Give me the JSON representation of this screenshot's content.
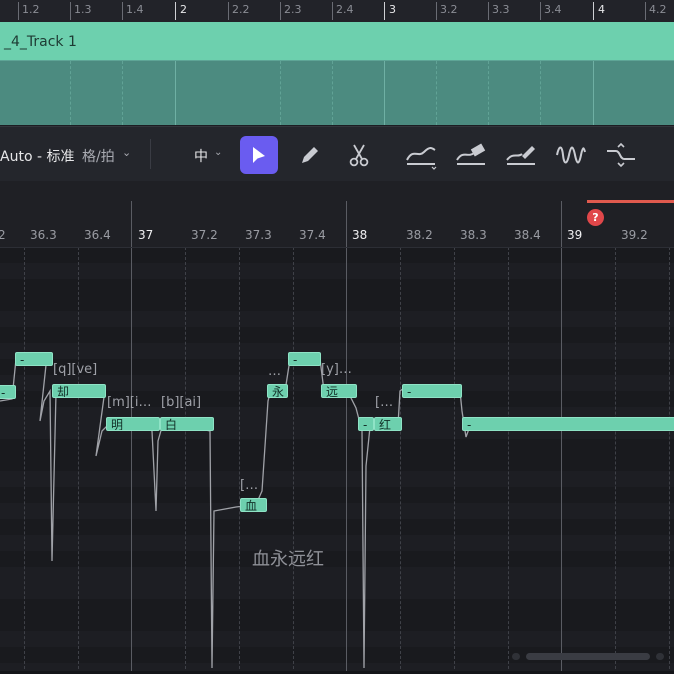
{
  "top_ruler": {
    "labels": [
      "1.2",
      "1.3",
      "1.4",
      "2",
      "2.2",
      "2.3",
      "2.4",
      "3",
      "3.2",
      "3.3",
      "3.4",
      "4",
      "4.2"
    ]
  },
  "track": {
    "name": "_4_Track 1"
  },
  "toolbar": {
    "mode": "Auto - 标准",
    "grid": "格/拍",
    "size": "中",
    "tools": [
      "select-tool",
      "pencil-tool",
      "scissors-tool",
      "pitch-curve-tool",
      "pitch-erase-tool",
      "pitch-line-tool",
      "vibrato-tool",
      "transition-tool"
    ]
  },
  "roll_ruler": {
    "labels": [
      "2",
      "36.3",
      "36.4",
      "37",
      "37.2",
      "37.3",
      "37.4",
      "38",
      "38.2",
      "38.3",
      "38.4",
      "39",
      "39.2"
    ]
  },
  "help_badge": "?",
  "notes": [
    {
      "text": "-"
    },
    {
      "text": "-"
    },
    {
      "text": "却"
    },
    {
      "text": "明"
    },
    {
      "text": "白"
    },
    {
      "text": "血"
    },
    {
      "text": "-"
    },
    {
      "text": "永"
    },
    {
      "text": "远"
    },
    {
      "text": "-"
    },
    {
      "text": "红"
    },
    {
      "text": "-"
    },
    {
      "text": "-"
    }
  ],
  "phonemes": [
    "[q][ve]",
    "[m][i…",
    "[b][ai]",
    "[…",
    "…",
    "[y]…",
    "[…"
  ],
  "lyric_overlay": "血永远红",
  "colors": {
    "note": "#6dd0ae",
    "accent": "#6a5cf0",
    "alert": "#e05a4e"
  }
}
